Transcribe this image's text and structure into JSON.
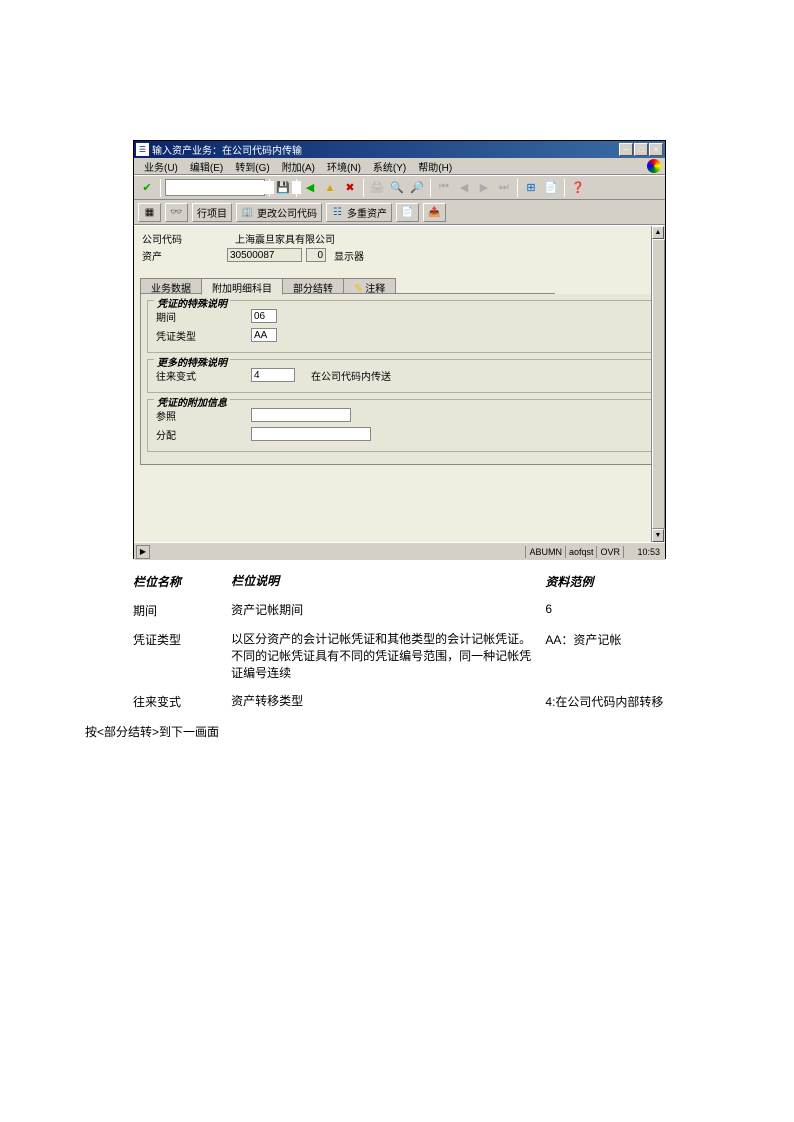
{
  "window": {
    "title": "输入资产业务：在公司代码内传输"
  },
  "menu": {
    "business": "业务(U)",
    "edit": "编辑(E)",
    "goto": "转到(G)",
    "addon": "附加(A)",
    "env": "环境(N)",
    "system": "系统(Y)",
    "help": "帮助(H)"
  },
  "toolbar2": {
    "line_items": "行项目",
    "change_company": "更改公司代码",
    "multi_assets": "多重资产"
  },
  "header": {
    "company_code_label": "公司代码",
    "company_name": "上海震旦家具有限公司",
    "asset_label": "资产",
    "asset_value": "30500087",
    "asset_sub_value": "0",
    "asset_desc": "显示器"
  },
  "tabs": {
    "t1": "业务数据",
    "t2": "附加明细科目",
    "t3": "部分结转",
    "t4": "注释"
  },
  "group1": {
    "title": "凭证的特殊说明",
    "period_label": "期间",
    "period_value": "06",
    "doc_type_label": "凭证类型",
    "doc_type_value": "AA"
  },
  "group2": {
    "title": "更多的特殊说明",
    "trans_type_label": "往来变式",
    "trans_type_value": "4",
    "trans_type_desc": "在公司代码内传送"
  },
  "group3": {
    "title": "凭证的附加信息",
    "ref_label": "参照",
    "ref_value": "",
    "assign_label": "分配",
    "assign_value": ""
  },
  "statusbar": {
    "s1": "ABUMN",
    "s2": "aofqst",
    "s3": "OVR",
    "s4": "10:53"
  },
  "doc": {
    "h1": "栏位名称",
    "h2": "栏位说明",
    "h3": "资料范例",
    "r1c1": "期间",
    "r1c2": "资产记帐期间",
    "r1c3": "6",
    "r2c1": "凭证类型",
    "r2c2": "以区分资产的会计记帐凭证和其他类型的会计记帐凭证。不同的记帐凭证具有不同的凭证编号范围，同一种记帐凭证编号连续",
    "r2c3": "AA：资产记帐",
    "r3c1": "往来变式",
    "r3c2": "资产转移类型",
    "r3c3": "4:在公司代码内部转移",
    "note": "按<部分结转>到下一画面"
  }
}
